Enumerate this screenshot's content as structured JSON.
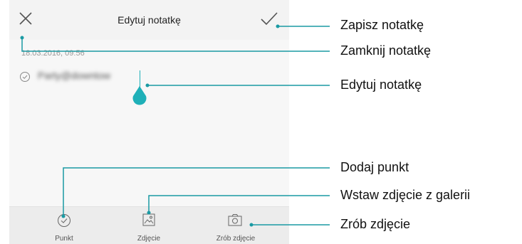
{
  "app": {
    "title": "Edytuj notatkę",
    "date": "18.03.2016, 09:56",
    "item_text": "Party@downtow"
  },
  "icons": {
    "close": "close-icon",
    "save": "check-icon",
    "item": "circle-check-icon",
    "punkt": "circle-check-icon",
    "zdjecie": "image-icon",
    "zrob": "camera-icon"
  },
  "bottombar": {
    "punkt": "Punkt",
    "zdjecie": "Zdjęcie",
    "zrob": "Zrób zdjęcie"
  },
  "callouts": {
    "zapisz": "Zapisz notatkę",
    "zamknij": "Zamknij notatkę",
    "edytuj": "Edytuj notatkę",
    "dodaj": "Dodaj punkt",
    "wstaw": "Wstaw zdjęcie z galerii",
    "zrob": "Zrób zdjęcie"
  },
  "colors": {
    "accent": "#1fb0b8",
    "callout_line": "#1a9aa3"
  }
}
